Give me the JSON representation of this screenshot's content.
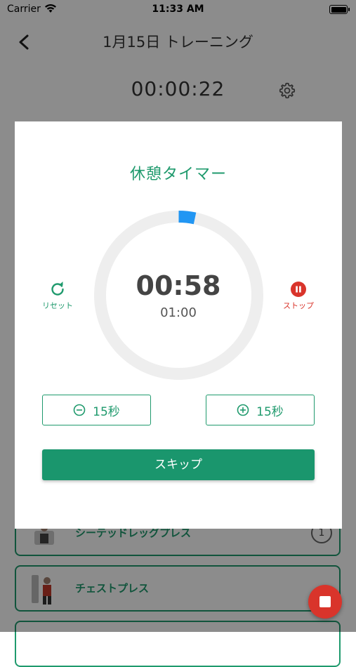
{
  "status_bar": {
    "carrier": "Carrier",
    "time": "11:33 AM"
  },
  "header": {
    "title": "1月15日 トレーニング",
    "elapsed": "00:00:22"
  },
  "exercises": [
    {
      "name": "シーテッドレッグプレス",
      "badge": "1"
    },
    {
      "name": "チェストプレス"
    }
  ],
  "modal": {
    "title": "休憩タイマー",
    "countdown": "00:58",
    "total": "01:00",
    "progress_elapsed_fraction": 0.033,
    "reset_label": "リセット",
    "stop_label": "ストップ",
    "minus_label": "15秒",
    "plus_label": "15秒",
    "skip_label": "スキップ"
  },
  "colors": {
    "accent": "#1f9a6d",
    "stop": "#d9342b",
    "progress": "#2196f3",
    "ring_track": "#eeeeee"
  }
}
